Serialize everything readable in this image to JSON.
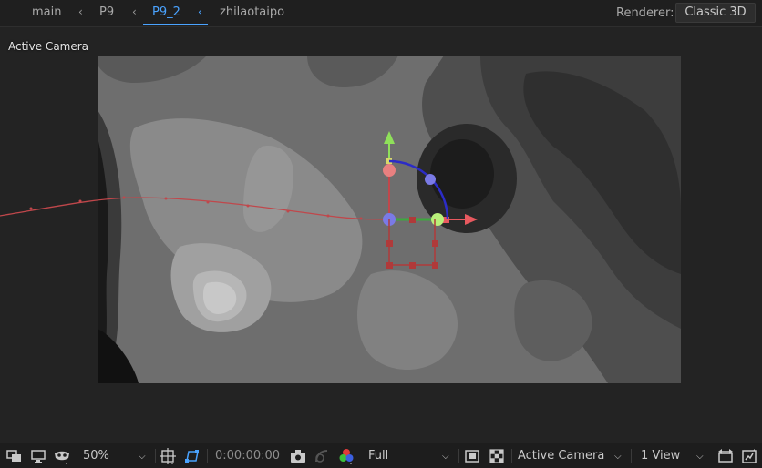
{
  "breadcrumb": {
    "items": [
      {
        "label": "main"
      },
      {
        "label": "P9"
      },
      {
        "label": "P9_2"
      },
      {
        "label": "zhilaotaipo"
      }
    ],
    "active_index": 2
  },
  "renderer": {
    "label": "Renderer:",
    "value": "Classic 3D"
  },
  "viewer": {
    "view_label": "Active Camera"
  },
  "toolbar": {
    "zoom": "50%",
    "timecode": "0:00:00:00",
    "resolution": "Full",
    "camera": "Active Camera",
    "view_layout": "1 View"
  },
  "colors": {
    "accent": "#4aa3ff",
    "gizmo_x": "#e8595f",
    "gizmo_y": "#8fe05a",
    "gizmo_z": "#3a3acb",
    "motion_path": "#c0474b"
  },
  "icons": [
    "region-of-interest-icon",
    "monitor-icon",
    "mask-visibility-icon",
    "grid-guides-icon",
    "mask-path-icon",
    "camera-snapshot-icon",
    "show-snapshot-icon",
    "color-channels-icon",
    "fast-previews-icon",
    "transparency-grid-icon",
    "reset-exposure-icon",
    "view-options-icon"
  ]
}
